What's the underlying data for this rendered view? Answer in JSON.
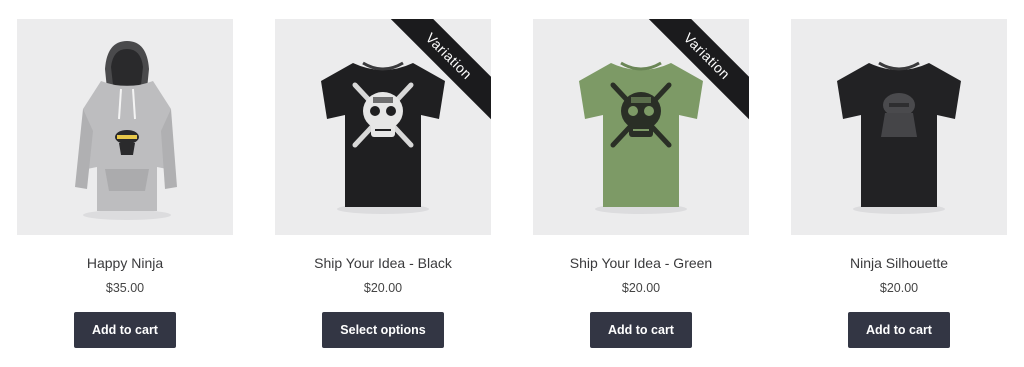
{
  "products": [
    {
      "title": "Happy Ninja",
      "price": "$35.00",
      "button": "Add to cart",
      "ribbon": null,
      "garment": "hoodie",
      "color": "#b9b9bb"
    },
    {
      "title": "Ship Your Idea - Black",
      "price": "$20.00",
      "button": "Select options",
      "ribbon": "Variation",
      "garment": "tshirt",
      "color": "#1f1f21"
    },
    {
      "title": "Ship Your Idea - Green",
      "price": "$20.00",
      "button": "Add to cart",
      "ribbon": "Variation",
      "garment": "tshirt",
      "color": "#7d9a66"
    },
    {
      "title": "Ninja Silhouette",
      "price": "$20.00",
      "button": "Add to cart",
      "ribbon": null,
      "garment": "tshirt",
      "color": "#222224"
    }
  ],
  "colors": {
    "button_bg": "#333644",
    "thumb_bg": "#ececed",
    "ribbon_bg": "#1b1b1d"
  }
}
